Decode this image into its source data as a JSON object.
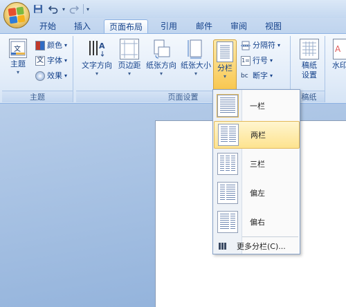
{
  "quick_access": {
    "save_icon": "save-icon",
    "undo_icon": "undo-icon",
    "redo_icon": "redo-icon",
    "customize_icon": "customize-icon"
  },
  "tabs": [
    {
      "label": "开始",
      "active": false
    },
    {
      "label": "插入",
      "active": false
    },
    {
      "label": "页面布局",
      "active": true
    },
    {
      "label": "引用",
      "active": false
    },
    {
      "label": "邮件",
      "active": false
    },
    {
      "label": "审阅",
      "active": false
    },
    {
      "label": "视图",
      "active": false
    }
  ],
  "ribbon": {
    "theme_group": {
      "label": "主题",
      "theme_button": "主题",
      "colors": "颜色",
      "fonts": "字体",
      "effects": "效果"
    },
    "page_setup_group": {
      "label": "页面设置",
      "text_direction": "文字方向",
      "margins": "页边距",
      "orientation": "纸张方向",
      "size": "纸张大小",
      "columns": "分栏",
      "breaks": "分隔符",
      "line_numbers": "行号",
      "hyphenation": "断字"
    },
    "manuscript_group": {
      "label": "稿纸",
      "settings_line1": "稿纸",
      "settings_line2": "设置"
    },
    "partial_right": "水印"
  },
  "columns_menu": {
    "items": [
      {
        "label": "一栏",
        "state": "checked"
      },
      {
        "label": "两栏",
        "state": "hover"
      },
      {
        "label": "三栏",
        "state": ""
      },
      {
        "label": "偏左",
        "state": ""
      },
      {
        "label": "偏右",
        "state": ""
      }
    ],
    "more": "更多分栏(C)..."
  },
  "colors": {
    "ribbon": "#e3edf9",
    "accent": "#f8c74f",
    "text": "#15428b"
  }
}
